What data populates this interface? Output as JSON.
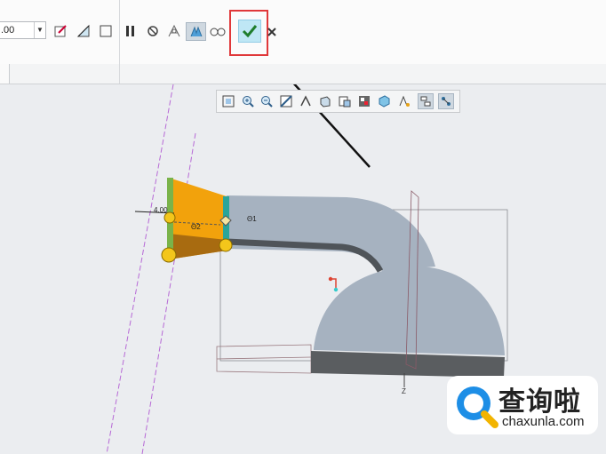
{
  "toolbar": {
    "dimension_value": ".00",
    "icons": [
      "sketch-icon",
      "plane-icon",
      "rectangle-icon",
      "pause-icon",
      "no-preview-icon",
      "preview-icon",
      "verify-icon",
      "glasses-icon",
      "ok-check-icon",
      "cancel-x-icon"
    ],
    "accent_colors": {
      "ok_button_bg": "#bfe7f5",
      "highlight_box": "#e0383a"
    }
  },
  "view_toolbar": {
    "icons": [
      "refit-icon",
      "zoom-in-icon",
      "zoom-out-icon",
      "repaint-icon",
      "perspective-icon",
      "display-style-icon",
      "saved-orientations-icon",
      "view-manager-icon",
      "datum-display-icon",
      "annotation-display-icon",
      "spin-center-icon",
      "feature-tree-icon"
    ]
  },
  "model": {
    "dimension_labels": [
      "4.00",
      "Θ1",
      "Θ2",
      "Z"
    ],
    "colors": {
      "body": "#a6b2c0",
      "face_orange": "#f2a20c",
      "face_dark": "#a86b10",
      "base": "#5a5d60",
      "handle": "#f3c61b"
    }
  },
  "watermark": {
    "cn_text": "查询啦",
    "url_text": "chaxunla.com"
  }
}
